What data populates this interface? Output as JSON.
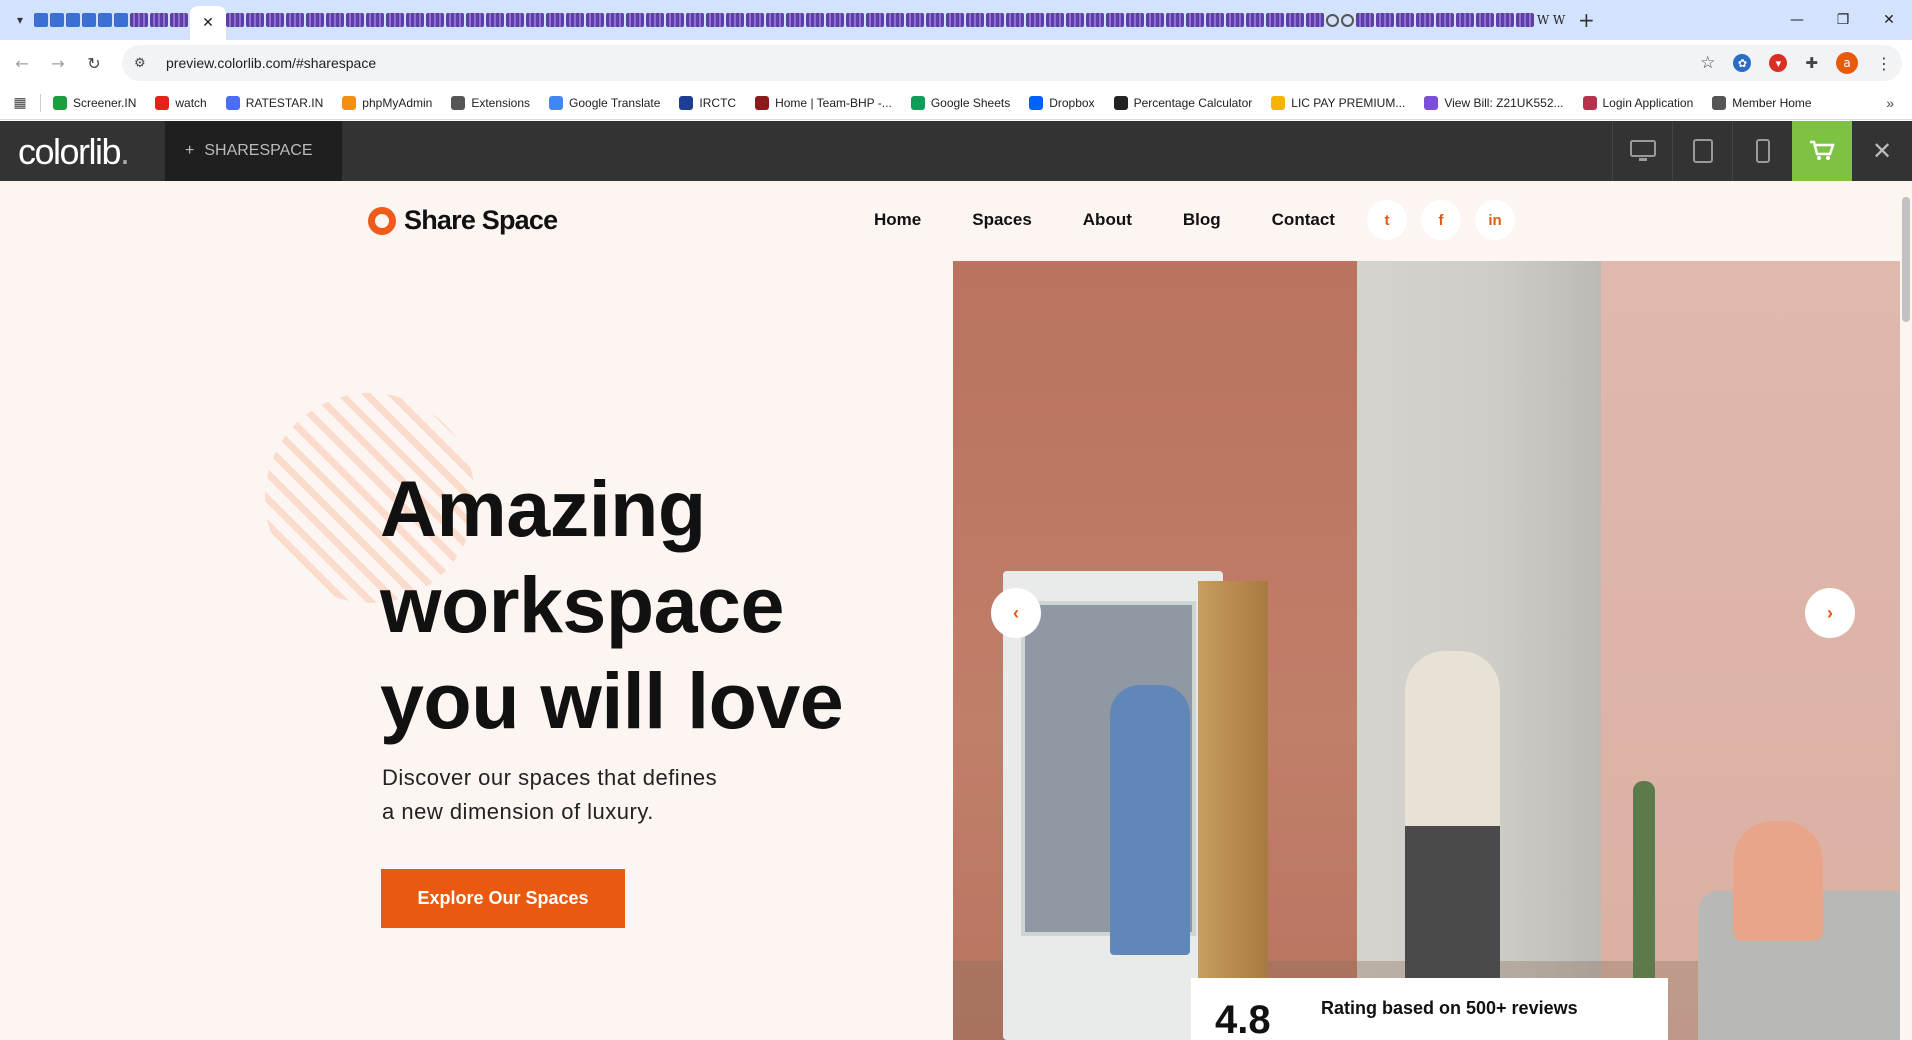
{
  "browser": {
    "active_tab_close": "✕",
    "new_tab": "+",
    "window_controls": [
      "—",
      "❐",
      "✕"
    ],
    "back": "←",
    "forward": "→",
    "reload": "↻",
    "url": "preview.colorlib.com/#sharespace",
    "avatar_letter": "a",
    "bookmarks": [
      {
        "label": "Screener.IN",
        "color": "#1b9e3e"
      },
      {
        "label": "watch",
        "color": "#e62117"
      },
      {
        "label": "RATESTAR.IN",
        "color": "#4a6cf7"
      },
      {
        "label": "phpMyAdmin",
        "color": "#f29111"
      },
      {
        "label": "Extensions",
        "color": "#555555"
      },
      {
        "label": "Google Translate",
        "color": "#4285f4"
      },
      {
        "label": "IRCTC",
        "color": "#1c3f94"
      },
      {
        "label": "Home | Team-BHP -...",
        "color": "#8b1a1a"
      },
      {
        "label": "Google Sheets",
        "color": "#0f9d58"
      },
      {
        "label": "Dropbox",
        "color": "#0061fe"
      },
      {
        "label": "Percentage Calculator",
        "color": "#222222"
      },
      {
        "label": "LIC PAY PREMIUM...",
        "color": "#f4b400"
      },
      {
        "label": "View Bill: Z21UK552...",
        "color": "#7b4fd6"
      },
      {
        "label": "Login Application",
        "color": "#b5334c"
      },
      {
        "label": "Member Home",
        "color": "#555555"
      }
    ],
    "bookmarks_more": "»"
  },
  "colorlib": {
    "logo": "colorlib",
    "logo_dot": ".",
    "theme_plus": "+",
    "theme_name": "SHARESPACE",
    "cart_color": "#7dc242",
    "close": "✕"
  },
  "site": {
    "logo_text": "Share Space",
    "accent": "#e9590f",
    "nav": [
      "Home",
      "Spaces",
      "About",
      "Blog",
      "Contact"
    ],
    "socials": [
      {
        "name": "twitter-icon",
        "glyph": "t"
      },
      {
        "name": "facebook-icon",
        "glyph": "f"
      },
      {
        "name": "linkedin-icon",
        "glyph": "in"
      }
    ],
    "hero": {
      "title_line1": "Amazing",
      "title_line2": "workspace",
      "title_line3": "you will love",
      "subtitle_line1": "Discover our spaces that defines",
      "subtitle_line2": "a new dimension of luxury.",
      "cta": "Explore Our Spaces"
    },
    "slider": {
      "prev": "‹",
      "next": "›"
    },
    "rating": {
      "value": "4.8",
      "text": "Rating based on 500+ reviews"
    }
  }
}
